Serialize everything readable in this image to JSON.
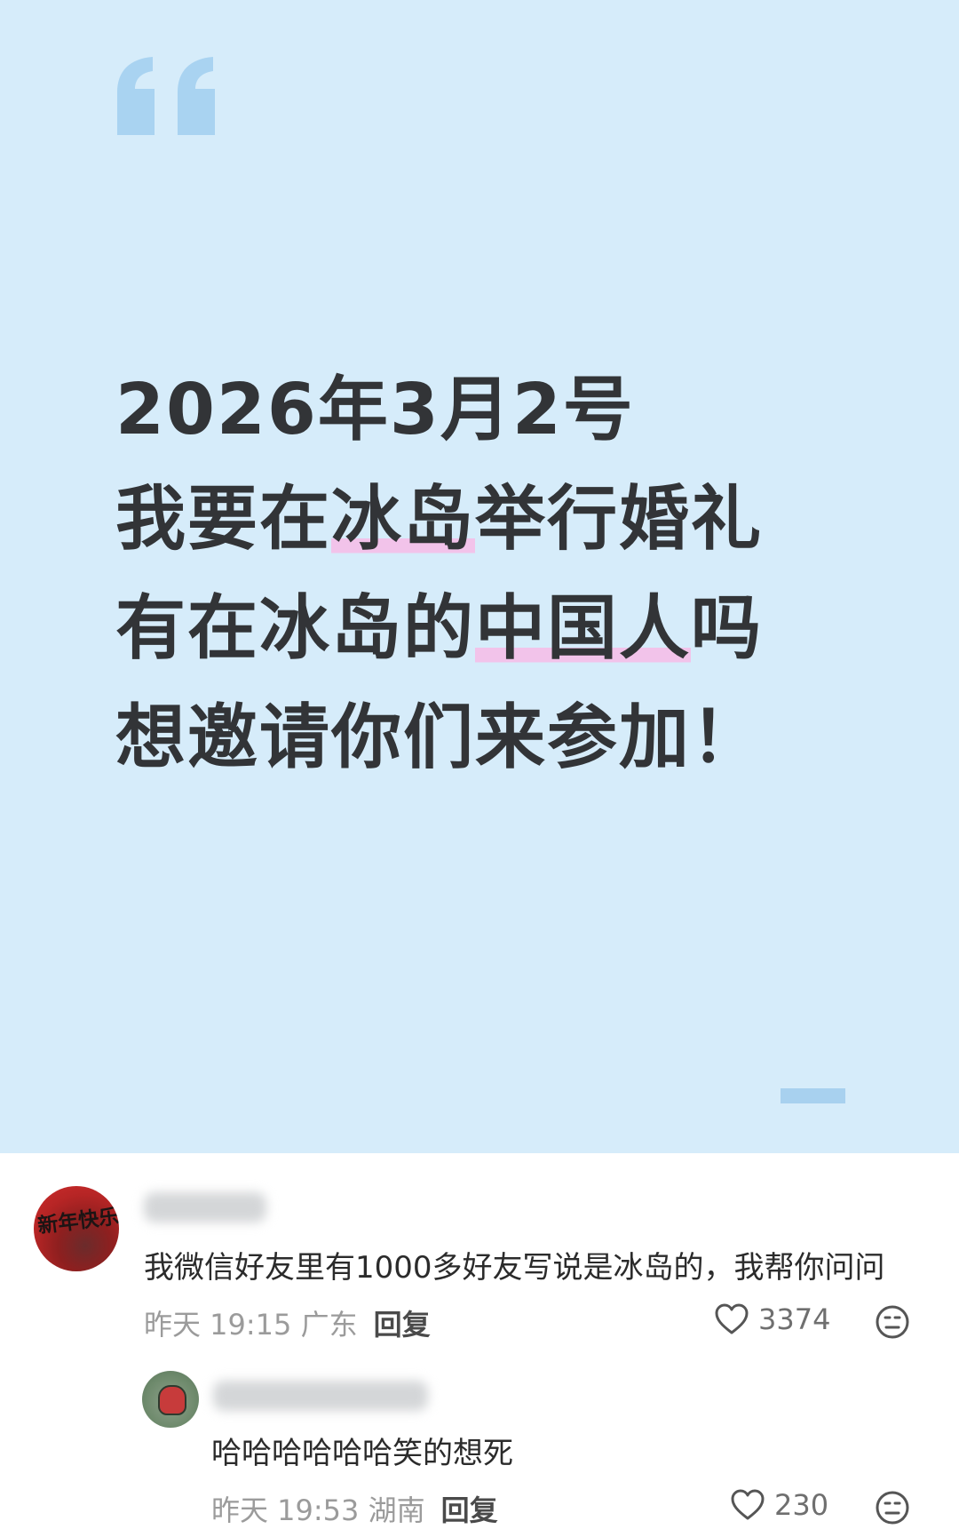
{
  "post": {
    "line1": "2026年3月2号",
    "line2_a": "我要在",
    "line2_hl": "冰岛",
    "line2_b": "举行婚礼",
    "line3_a": "有在冰岛的",
    "line3_hl": "中国人",
    "line3_b": "吗",
    "line4": "想邀请你们来参加！",
    "background_color": "#d6ecfa",
    "highlight_color": "#f2c3ea",
    "quote_icon": "quote-icon"
  },
  "comments": [
    {
      "avatar_icon": "avatar-image",
      "avatar_text": "新年快乐",
      "text": "我微信好友里有1000多好友写说是冰岛的，我帮你问问",
      "time": "昨天 19:15 广东",
      "reply_label": "回复",
      "likes": "3374",
      "like_icon": "heart-icon",
      "emoji_icon": "emoji-icon"
    },
    {
      "avatar_icon": "avatar-image",
      "text": "哈哈哈哈哈哈笑的想死",
      "time": "昨天 19:53 湖南",
      "reply_label": "回复",
      "likes": "230",
      "like_icon": "heart-icon",
      "emoji_icon": "emoji-icon"
    }
  ]
}
